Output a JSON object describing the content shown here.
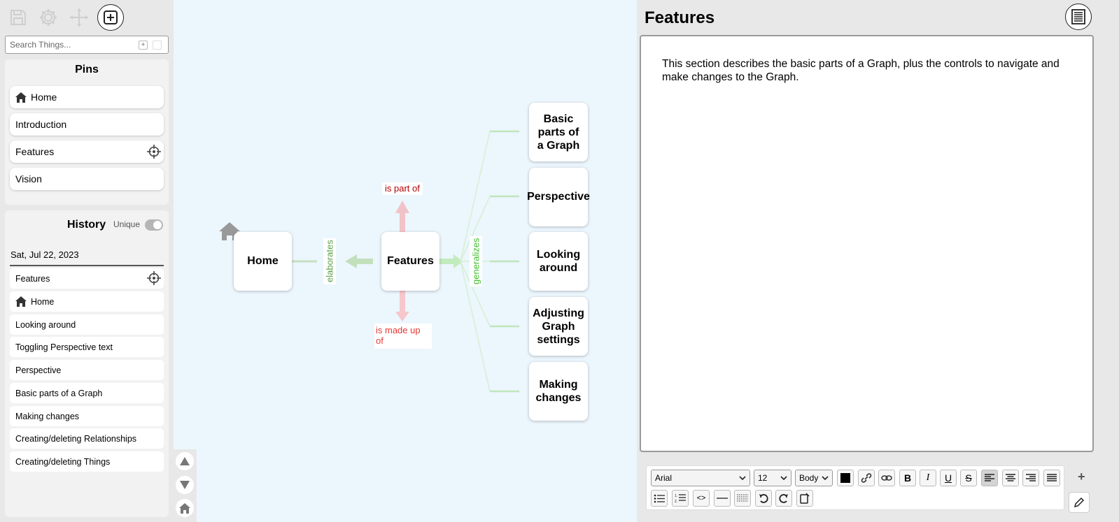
{
  "search": {
    "placeholder": "Search Things..."
  },
  "pins": {
    "title": "Pins",
    "items": [
      {
        "label": "Home"
      },
      {
        "label": "Introduction"
      },
      {
        "label": "Features"
      },
      {
        "label": "Vision"
      }
    ]
  },
  "history": {
    "title": "History",
    "unique_label": "Unique",
    "unique_on": false,
    "date": "Sat, Jul 22, 2023",
    "items": [
      {
        "label": "Features"
      },
      {
        "label": "Home"
      },
      {
        "label": "Looking around"
      },
      {
        "label": "Toggling Perspective text"
      },
      {
        "label": "Perspective"
      },
      {
        "label": "Basic parts of a Graph"
      },
      {
        "label": "Making changes"
      },
      {
        "label": "Creating/deleting Relationships"
      },
      {
        "label": "Creating/deleting Things"
      }
    ]
  },
  "graph": {
    "center": "Features",
    "home": "Home",
    "relations": {
      "elaborates": "elaborates",
      "generalizes": "generalizes",
      "is_part_of": "is part of",
      "is_made_up_of": "is made up of"
    },
    "children": [
      {
        "label": "Basic parts of a Graph"
      },
      {
        "label": "Perspective"
      },
      {
        "label": "Looking around"
      },
      {
        "label": "Adjusting Graph settings"
      },
      {
        "label": "Making changes"
      }
    ],
    "colors": {
      "background": "#ecf6fd",
      "elaborates": "#5a9e45",
      "generalizes": "#3fbf2a",
      "is_part_of": "#b30000",
      "is_made_up_of": "#e53935"
    }
  },
  "detail": {
    "title": "Features",
    "body": "This section describes the basic parts of a Graph, plus the controls to navigate and make changes to the Graph."
  },
  "editor_toolbar": {
    "font": "Arial",
    "size": "12",
    "style": "Body",
    "bold": "B",
    "italic": "I",
    "underline": "U",
    "strike": "S",
    "code": "<>"
  }
}
